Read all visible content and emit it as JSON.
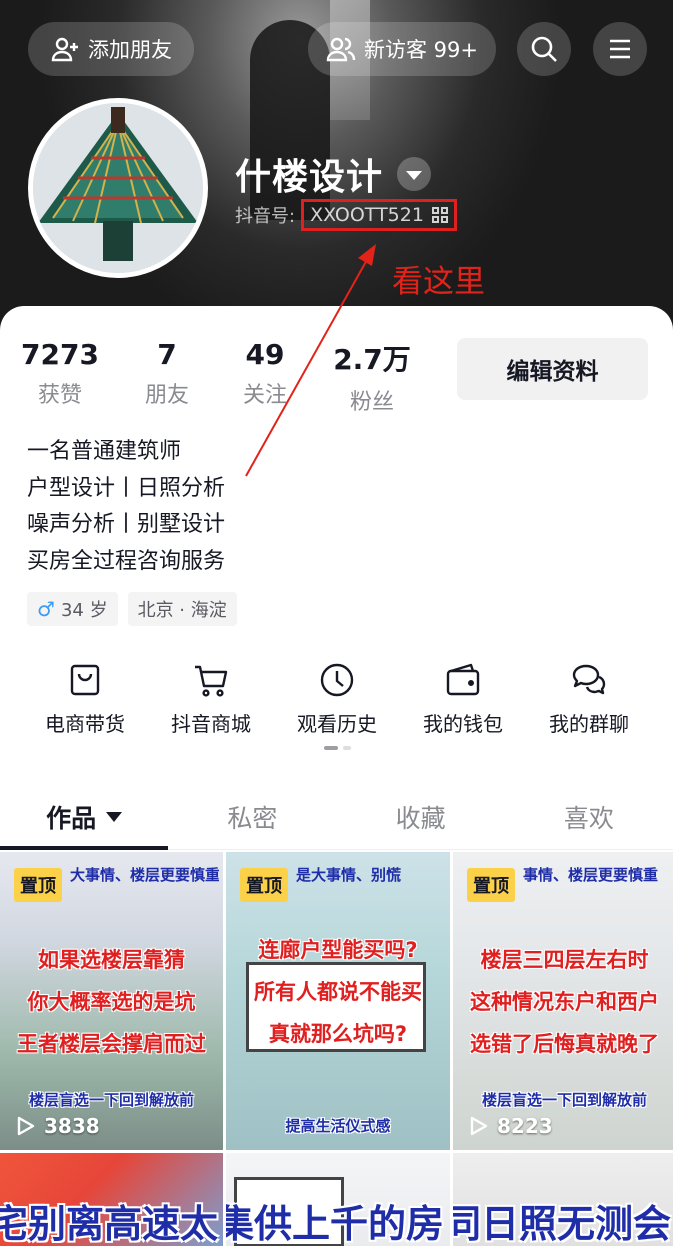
{
  "header": {
    "add_friend": "添加朋友",
    "visitors": "新访客 99+",
    "name": "什楼设计",
    "id_label": "抖音号:",
    "id_value": "XXOOTT521",
    "annotation": "看这里"
  },
  "colors": {
    "annotation_red": "#e2231a",
    "pin_yellow": "#fcd14a",
    "caption_blue": "#1f2ea8"
  },
  "stats": [
    {
      "num": "7273",
      "label": "获赞"
    },
    {
      "num": "7",
      "label": "朋友"
    },
    {
      "num": "49",
      "label": "关注"
    },
    {
      "num": "2.7万",
      "label": "粉丝"
    }
  ],
  "edit_profile": "编辑资料",
  "bio": [
    "一名普通建筑师",
    "户型设计丨日照分析",
    "噪声分析丨别墅设计",
    "买房全过程咨询服务"
  ],
  "tags": {
    "gender_symbol": "♂",
    "age": "34 岁",
    "location": "北京 · 海淀"
  },
  "shortcuts": [
    {
      "label": "电商带货",
      "icon": "shopping-bag-icon"
    },
    {
      "label": "抖音商城",
      "icon": "cart-icon"
    },
    {
      "label": "观看历史",
      "icon": "clock-icon"
    },
    {
      "label": "我的钱包",
      "icon": "wallet-icon"
    },
    {
      "label": "我的群聊",
      "icon": "chat-bubbles-icon"
    }
  ],
  "tabs": [
    "作品",
    "私密",
    "收藏",
    "喜欢"
  ],
  "videos": [
    {
      "pin": "置顶",
      "top": "大事情、楼层更要慎重",
      "lines": [
        "如果选楼层靠猜",
        "你大概率选的是坑",
        "王者楼层会撑肩而过"
      ],
      "bottom": "楼层盲选一下回到解放前",
      "plays": "3838"
    },
    {
      "pin": "置顶",
      "top": "是大事情、别慌",
      "lines": [
        "连廊户型能买吗?",
        "所有人都说不能买",
        "真就那么坑吗?"
      ],
      "bottom": "提高生活仪式感",
      "plays": ""
    },
    {
      "pin": "置顶",
      "top": "事情、楼层更要慎重",
      "lines": [
        "楼层三四层左右时",
        "这种情况东户和西户",
        "选错了后悔真就晚了"
      ],
      "bottom": "楼层盲选一下回到解放前",
      "plays": "8223"
    },
    {
      "partial": "宅别离高速太"
    },
    {
      "partial": "集供上千的房"
    },
    {
      "partial": "同日照无测会"
    }
  ]
}
